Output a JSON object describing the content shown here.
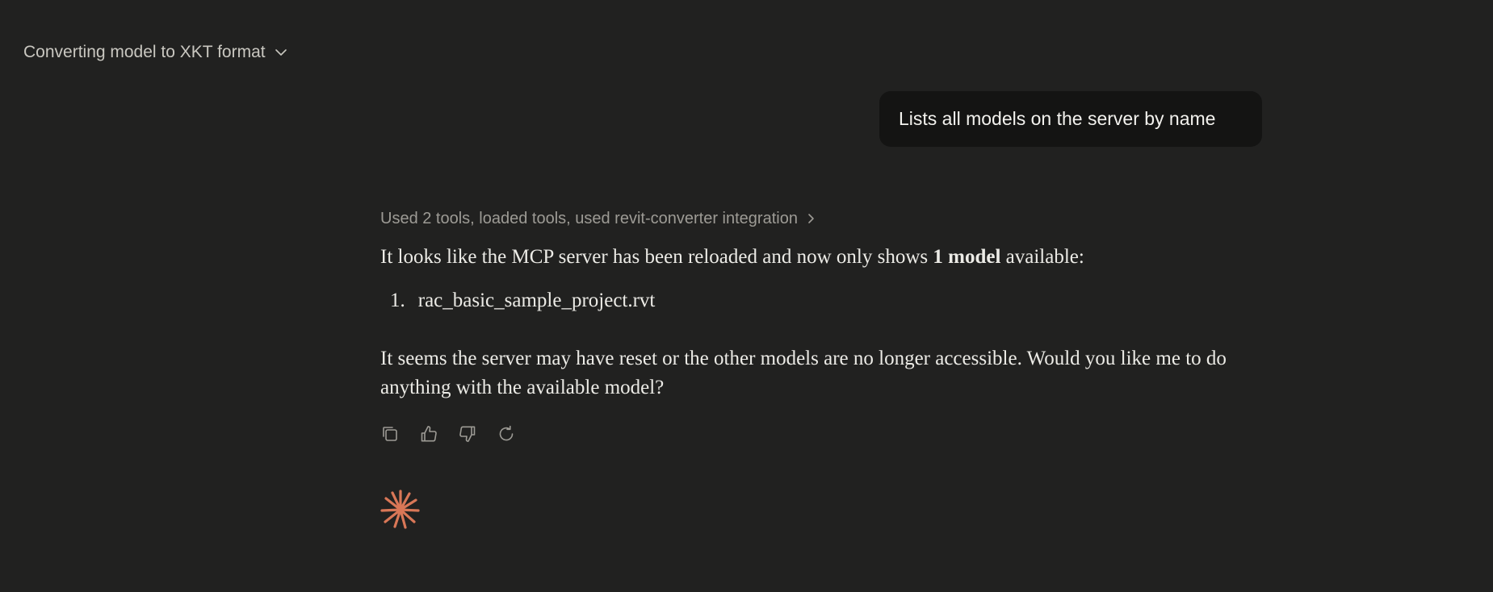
{
  "header": {
    "title": "Converting model to XKT format",
    "dropdown_icon": "chevron-down-icon"
  },
  "user_message": {
    "text": "Lists all models on the server by name"
  },
  "assistant_message": {
    "tools_summary": "Used 2 tools, loaded tools, used revit-converter integration",
    "tools_icon": "chevron-right-icon",
    "paragraph1_before": "It looks like the MCP server has been reloaded and now only shows ",
    "paragraph1_bold": "1 model",
    "paragraph1_after": " available:",
    "list_items": [
      {
        "number": "1.",
        "text": "rac_basic_sample_project.rvt"
      }
    ],
    "paragraph2": "It seems the server may have reset or the other models are no longer accessible. Would you like me to do anything with the available model?",
    "actions": [
      {
        "name": "copy",
        "icon": "copy-icon"
      },
      {
        "name": "thumbs-up",
        "icon": "thumbs-up-icon"
      },
      {
        "name": "thumbs-down",
        "icon": "thumbs-down-icon"
      },
      {
        "name": "retry",
        "icon": "retry-icon"
      }
    ]
  },
  "colors": {
    "background": "#212120",
    "user_bubble": "#141413",
    "accent": "#d97757",
    "text": "#ecebe6",
    "muted_text": "#9d9b95"
  }
}
